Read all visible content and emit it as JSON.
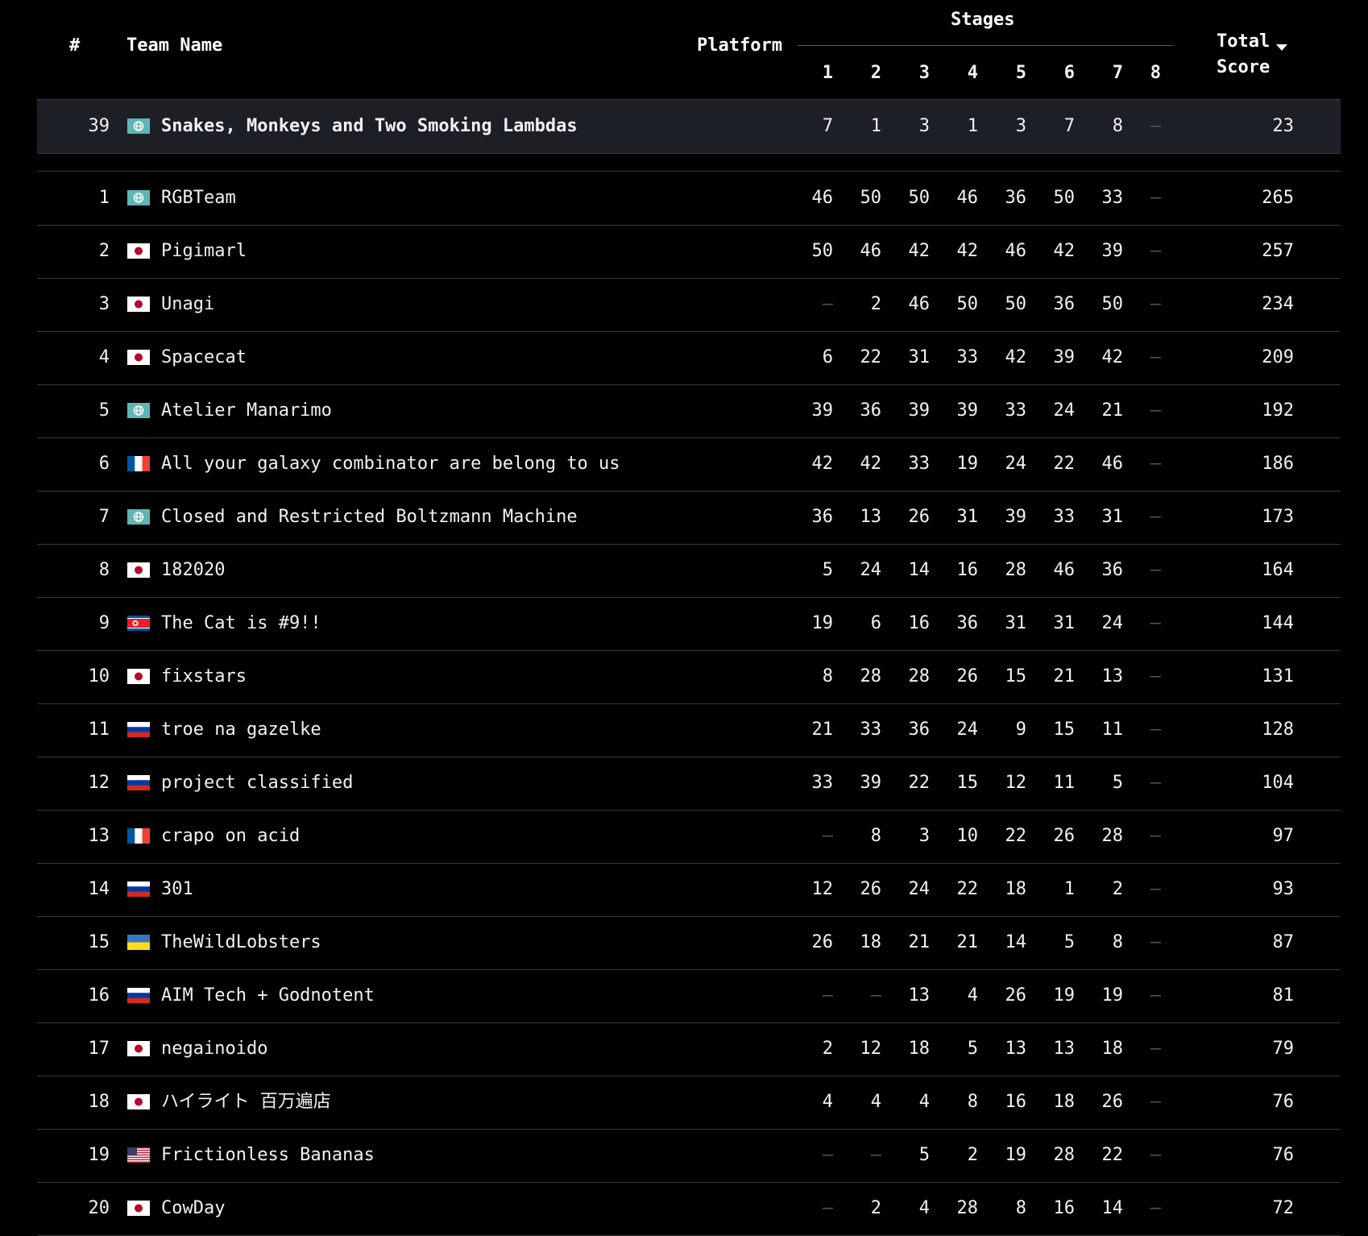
{
  "header": {
    "rank_label": "#",
    "team_label": "Team Name",
    "platform_label": "Platform",
    "stages_label": "Stages",
    "stage_numbers": [
      "1",
      "2",
      "3",
      "4",
      "5",
      "6",
      "7",
      "8"
    ],
    "total_label_line1": "Total",
    "total_label_line2": "Score",
    "sort_icon": "sort-desc-icon"
  },
  "colors": {
    "background": "#000000",
    "highlight_row": "#1c2026",
    "divider": "#3a3a3a",
    "dash": "#555555"
  },
  "highlighted_team": {
    "rank": "39",
    "flag": "globe",
    "name": "Snakes, Monkeys and Two Smoking Lambdas",
    "scores": [
      "7",
      "1",
      "3",
      "1",
      "3",
      "7",
      "8",
      "—"
    ],
    "total": "23"
  },
  "teams": [
    {
      "rank": "1",
      "flag": "globe",
      "name": "RGBTeam",
      "scores": [
        "46",
        "50",
        "50",
        "46",
        "36",
        "50",
        "33",
        "—"
      ],
      "total": "265"
    },
    {
      "rank": "2",
      "flag": "jp",
      "name": "Pigimarl",
      "scores": [
        "50",
        "46",
        "42",
        "42",
        "46",
        "42",
        "39",
        "—"
      ],
      "total": "257"
    },
    {
      "rank": "3",
      "flag": "jp",
      "name": "Unagi",
      "scores": [
        "—",
        "2",
        "46",
        "50",
        "50",
        "36",
        "50",
        "—"
      ],
      "total": "234"
    },
    {
      "rank": "4",
      "flag": "jp",
      "name": "Spacecat",
      "scores": [
        "6",
        "22",
        "31",
        "33",
        "42",
        "39",
        "42",
        "—"
      ],
      "total": "209"
    },
    {
      "rank": "5",
      "flag": "globe",
      "name": "Atelier Manarimo",
      "scores": [
        "39",
        "36",
        "39",
        "39",
        "33",
        "24",
        "21",
        "—"
      ],
      "total": "192"
    },
    {
      "rank": "6",
      "flag": "fr",
      "name": "All your galaxy combinator are belong to us",
      "scores": [
        "42",
        "42",
        "33",
        "19",
        "24",
        "22",
        "46",
        "—"
      ],
      "total": "186"
    },
    {
      "rank": "7",
      "flag": "globe",
      "name": "Closed and Restricted Boltzmann Machine",
      "scores": [
        "36",
        "13",
        "26",
        "31",
        "39",
        "33",
        "31",
        "—"
      ],
      "total": "173"
    },
    {
      "rank": "8",
      "flag": "jp",
      "name": "182020",
      "scores": [
        "5",
        "24",
        "14",
        "16",
        "28",
        "46",
        "36",
        "—"
      ],
      "total": "164"
    },
    {
      "rank": "9",
      "flag": "kp",
      "name": "The Cat is #9!!",
      "scores": [
        "19",
        "6",
        "16",
        "36",
        "31",
        "31",
        "24",
        "—"
      ],
      "total": "144"
    },
    {
      "rank": "10",
      "flag": "jp",
      "name": "fixstars",
      "scores": [
        "8",
        "28",
        "28",
        "26",
        "15",
        "21",
        "13",
        "—"
      ],
      "total": "131"
    },
    {
      "rank": "11",
      "flag": "ru",
      "name": "troe na gazelke",
      "scores": [
        "21",
        "33",
        "36",
        "24",
        "9",
        "15",
        "11",
        "—"
      ],
      "total": "128"
    },
    {
      "rank": "12",
      "flag": "ru",
      "name": "project classified",
      "scores": [
        "33",
        "39",
        "22",
        "15",
        "12",
        "11",
        "5",
        "—"
      ],
      "total": "104"
    },
    {
      "rank": "13",
      "flag": "fr",
      "name": "crapo on acid",
      "scores": [
        "—",
        "8",
        "3",
        "10",
        "22",
        "26",
        "28",
        "—"
      ],
      "total": "97"
    },
    {
      "rank": "14",
      "flag": "ru",
      "name": "301",
      "scores": [
        "12",
        "26",
        "24",
        "22",
        "18",
        "1",
        "2",
        "—"
      ],
      "total": "93"
    },
    {
      "rank": "15",
      "flag": "ua",
      "name": "TheWildLobsters",
      "scores": [
        "26",
        "18",
        "21",
        "21",
        "14",
        "5",
        "8",
        "—"
      ],
      "total": "87"
    },
    {
      "rank": "16",
      "flag": "ru",
      "name": "AIM Tech + Godnotent",
      "scores": [
        "—",
        "—",
        "13",
        "4",
        "26",
        "19",
        "19",
        "—"
      ],
      "total": "81"
    },
    {
      "rank": "17",
      "flag": "jp",
      "name": "negainoido",
      "scores": [
        "2",
        "12",
        "18",
        "5",
        "13",
        "13",
        "18",
        "—"
      ],
      "total": "79"
    },
    {
      "rank": "18",
      "flag": "jp",
      "name": "ハイライト 百万遍店",
      "scores": [
        "4",
        "4",
        "4",
        "8",
        "16",
        "18",
        "26",
        "—"
      ],
      "total": "76"
    },
    {
      "rank": "19",
      "flag": "us",
      "name": "Frictionless Bananas",
      "scores": [
        "—",
        "—",
        "5",
        "2",
        "19",
        "28",
        "22",
        "—"
      ],
      "total": "76"
    },
    {
      "rank": "20",
      "flag": "jp",
      "name": "CowDay",
      "scores": [
        "—",
        "2",
        "4",
        "28",
        "8",
        "16",
        "14",
        "—"
      ],
      "total": "72"
    }
  ]
}
